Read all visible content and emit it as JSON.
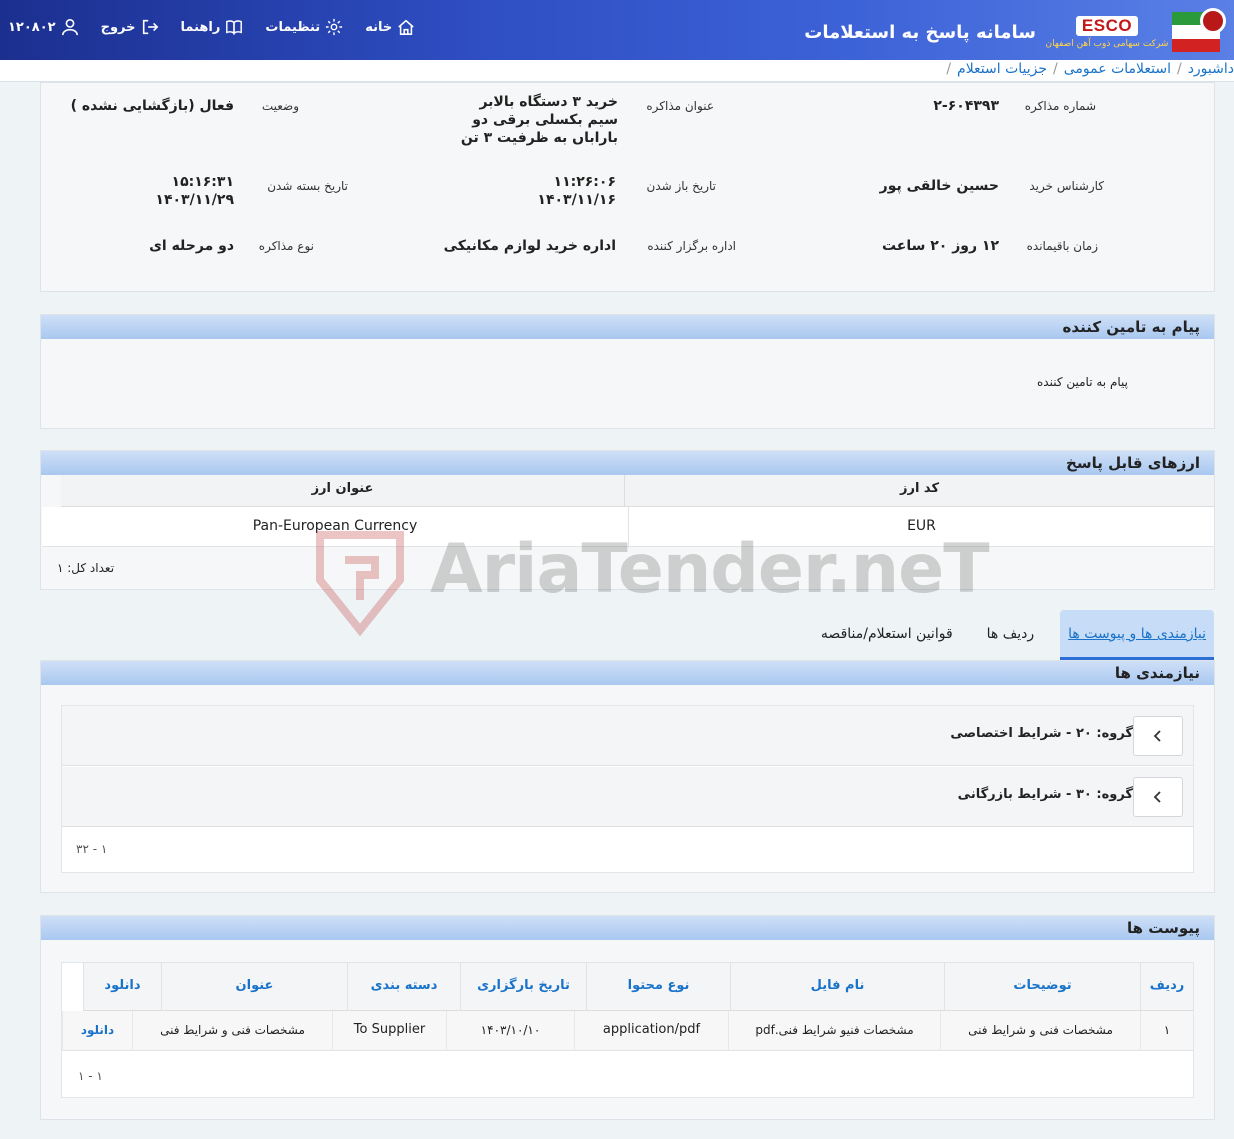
{
  "header": {
    "app_title": "سامانه پاسخ به استعلامات",
    "brand_logo": "ESCO",
    "brand_sub": "شرکت سهامی ذوب آهن اصفهان",
    "nav": {
      "home": "خانه",
      "settings": "تنظیمات",
      "guide": "راهنما",
      "logout": "خروج",
      "user_code": "۱۲۰۸۰۲"
    }
  },
  "breadcrumb": {
    "items": [
      "داشبورد",
      "استعلامات عمومی",
      "جزییات استعلام"
    ],
    "sep": "/"
  },
  "details": {
    "number_label": "شماره مذاکره",
    "number_value": "۲-۶۰۴۳۹۳",
    "title_label": "عنوان مذاکره",
    "title_value": "خرید ۳ دستگاه بالابر سیم بکسلی برقی دو باراباں به ظرفیت ۳ تن",
    "status_label": "وضعیت",
    "status_value": "فعال (بازگشایی نشده )",
    "buyer_label": "کارشناس خرید",
    "buyer_value": "حسین خالقی پور",
    "open_label": "تاریخ باز شدن",
    "open_time": "۱۱:۲۶:۰۶",
    "open_date": "۱۴۰۳/۱۱/۱۶",
    "close_label": "تاریخ بسته شدن",
    "close_time": "۱۵:۱۶:۳۱",
    "close_date": "۱۴۰۳/۱۱/۲۹",
    "remain_label": "زمان باقیمانده",
    "remain_value": "۱۲ روز ۲۰ ساعت",
    "office_label": "اداره برگزار کننده",
    "office_value": "اداره خرید لوازم مکانیکی",
    "type_label": "نوع مذاکره",
    "type_value": "دو مرحله ای"
  },
  "message": {
    "head": "پیام به تامین کننده",
    "text": "پیام به تامین کننده"
  },
  "currencies": {
    "head": "ارزهای قابل پاسخ",
    "col_code": "کد ارز",
    "col_title": "عنوان ارز",
    "rows": [
      {
        "code": "EUR",
        "title": "Pan-European Currency"
      }
    ],
    "count": "تعداد کل: ۱"
  },
  "tabs": {
    "needs": "نیازمندی ها و پیوست ها",
    "rows": "ردیف ها",
    "rules": "قوانین استعلام/مناقصه"
  },
  "requirements": {
    "head": "نیازمندی ها",
    "groups": [
      "گروه: ۲۰ - شرایط اختصاصی",
      "گروه: ۳۰ - شرایط بازرگانی"
    ],
    "pager": "۱ - ۳۲"
  },
  "attachments": {
    "head": "پیوست ها",
    "cols": [
      "ردیف",
      "توضیحات",
      "نام فایل",
      "نوع محتوا",
      "تاریخ بارگزاری",
      "دسته بندی",
      "عنوان",
      "دانلود"
    ],
    "row": [
      "۱",
      "مشخصات فنی و شرایط فنی",
      "مشخصات فنیو شرایط فنی.pdf",
      "application/pdf",
      "۱۴۰۳/۱۰/۱۰",
      "To Supplier",
      "مشخصات فنی و شرایط فنی",
      "دانلود"
    ],
    "pager": "۱ - ۱"
  },
  "watermark": "AriaTender.neT",
  "colors": {
    "header_dark": "#1b2f8f",
    "link": "#1a73c8",
    "panel_head": "#a9c8f0"
  }
}
